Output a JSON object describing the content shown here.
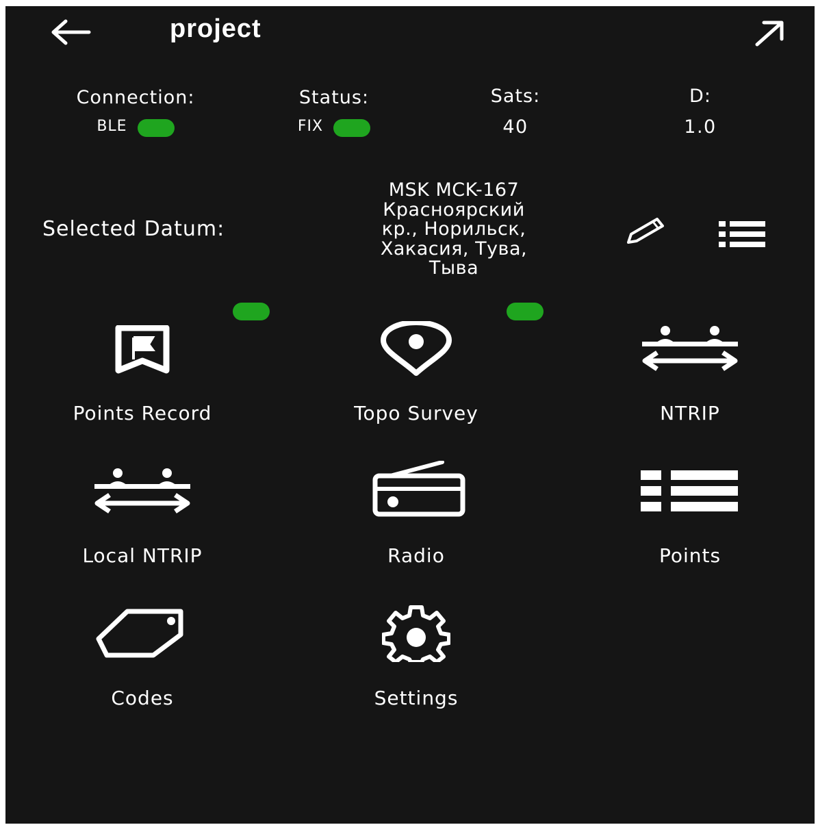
{
  "header": {
    "title": "project"
  },
  "status_bar": {
    "connection": {
      "label": "Connection:",
      "value": "BLE"
    },
    "status": {
      "label": "Status:",
      "value": "FIX"
    },
    "sats": {
      "label": "Sats:",
      "value": "40"
    },
    "d": {
      "label": "D:",
      "value": "1.0"
    },
    "indicator_color": "#1fa51f"
  },
  "datum": {
    "label": "Selected Datum:",
    "lines": [
      "MSK MCK-167",
      "Красноярский",
      "кр., Норильск,",
      "Хакасия, Тува,",
      "Тыва"
    ]
  },
  "tiles": [
    {
      "label": "Points Record",
      "icon": "flag-bookmark-icon",
      "indicator": true
    },
    {
      "label": "Topo Survey",
      "icon": "location-pin-icon",
      "indicator": true
    },
    {
      "label": "NTRIP",
      "icon": "users-exchange-icon"
    },
    {
      "label": "Local NTRIP",
      "icon": "users-exchange-icon"
    },
    {
      "label": "Radio",
      "icon": "radio-icon"
    },
    {
      "label": "Points",
      "icon": "list-icon"
    },
    {
      "label": "Codes",
      "icon": "tag-icon"
    },
    {
      "label": "Settings",
      "icon": "gear-icon"
    }
  ]
}
